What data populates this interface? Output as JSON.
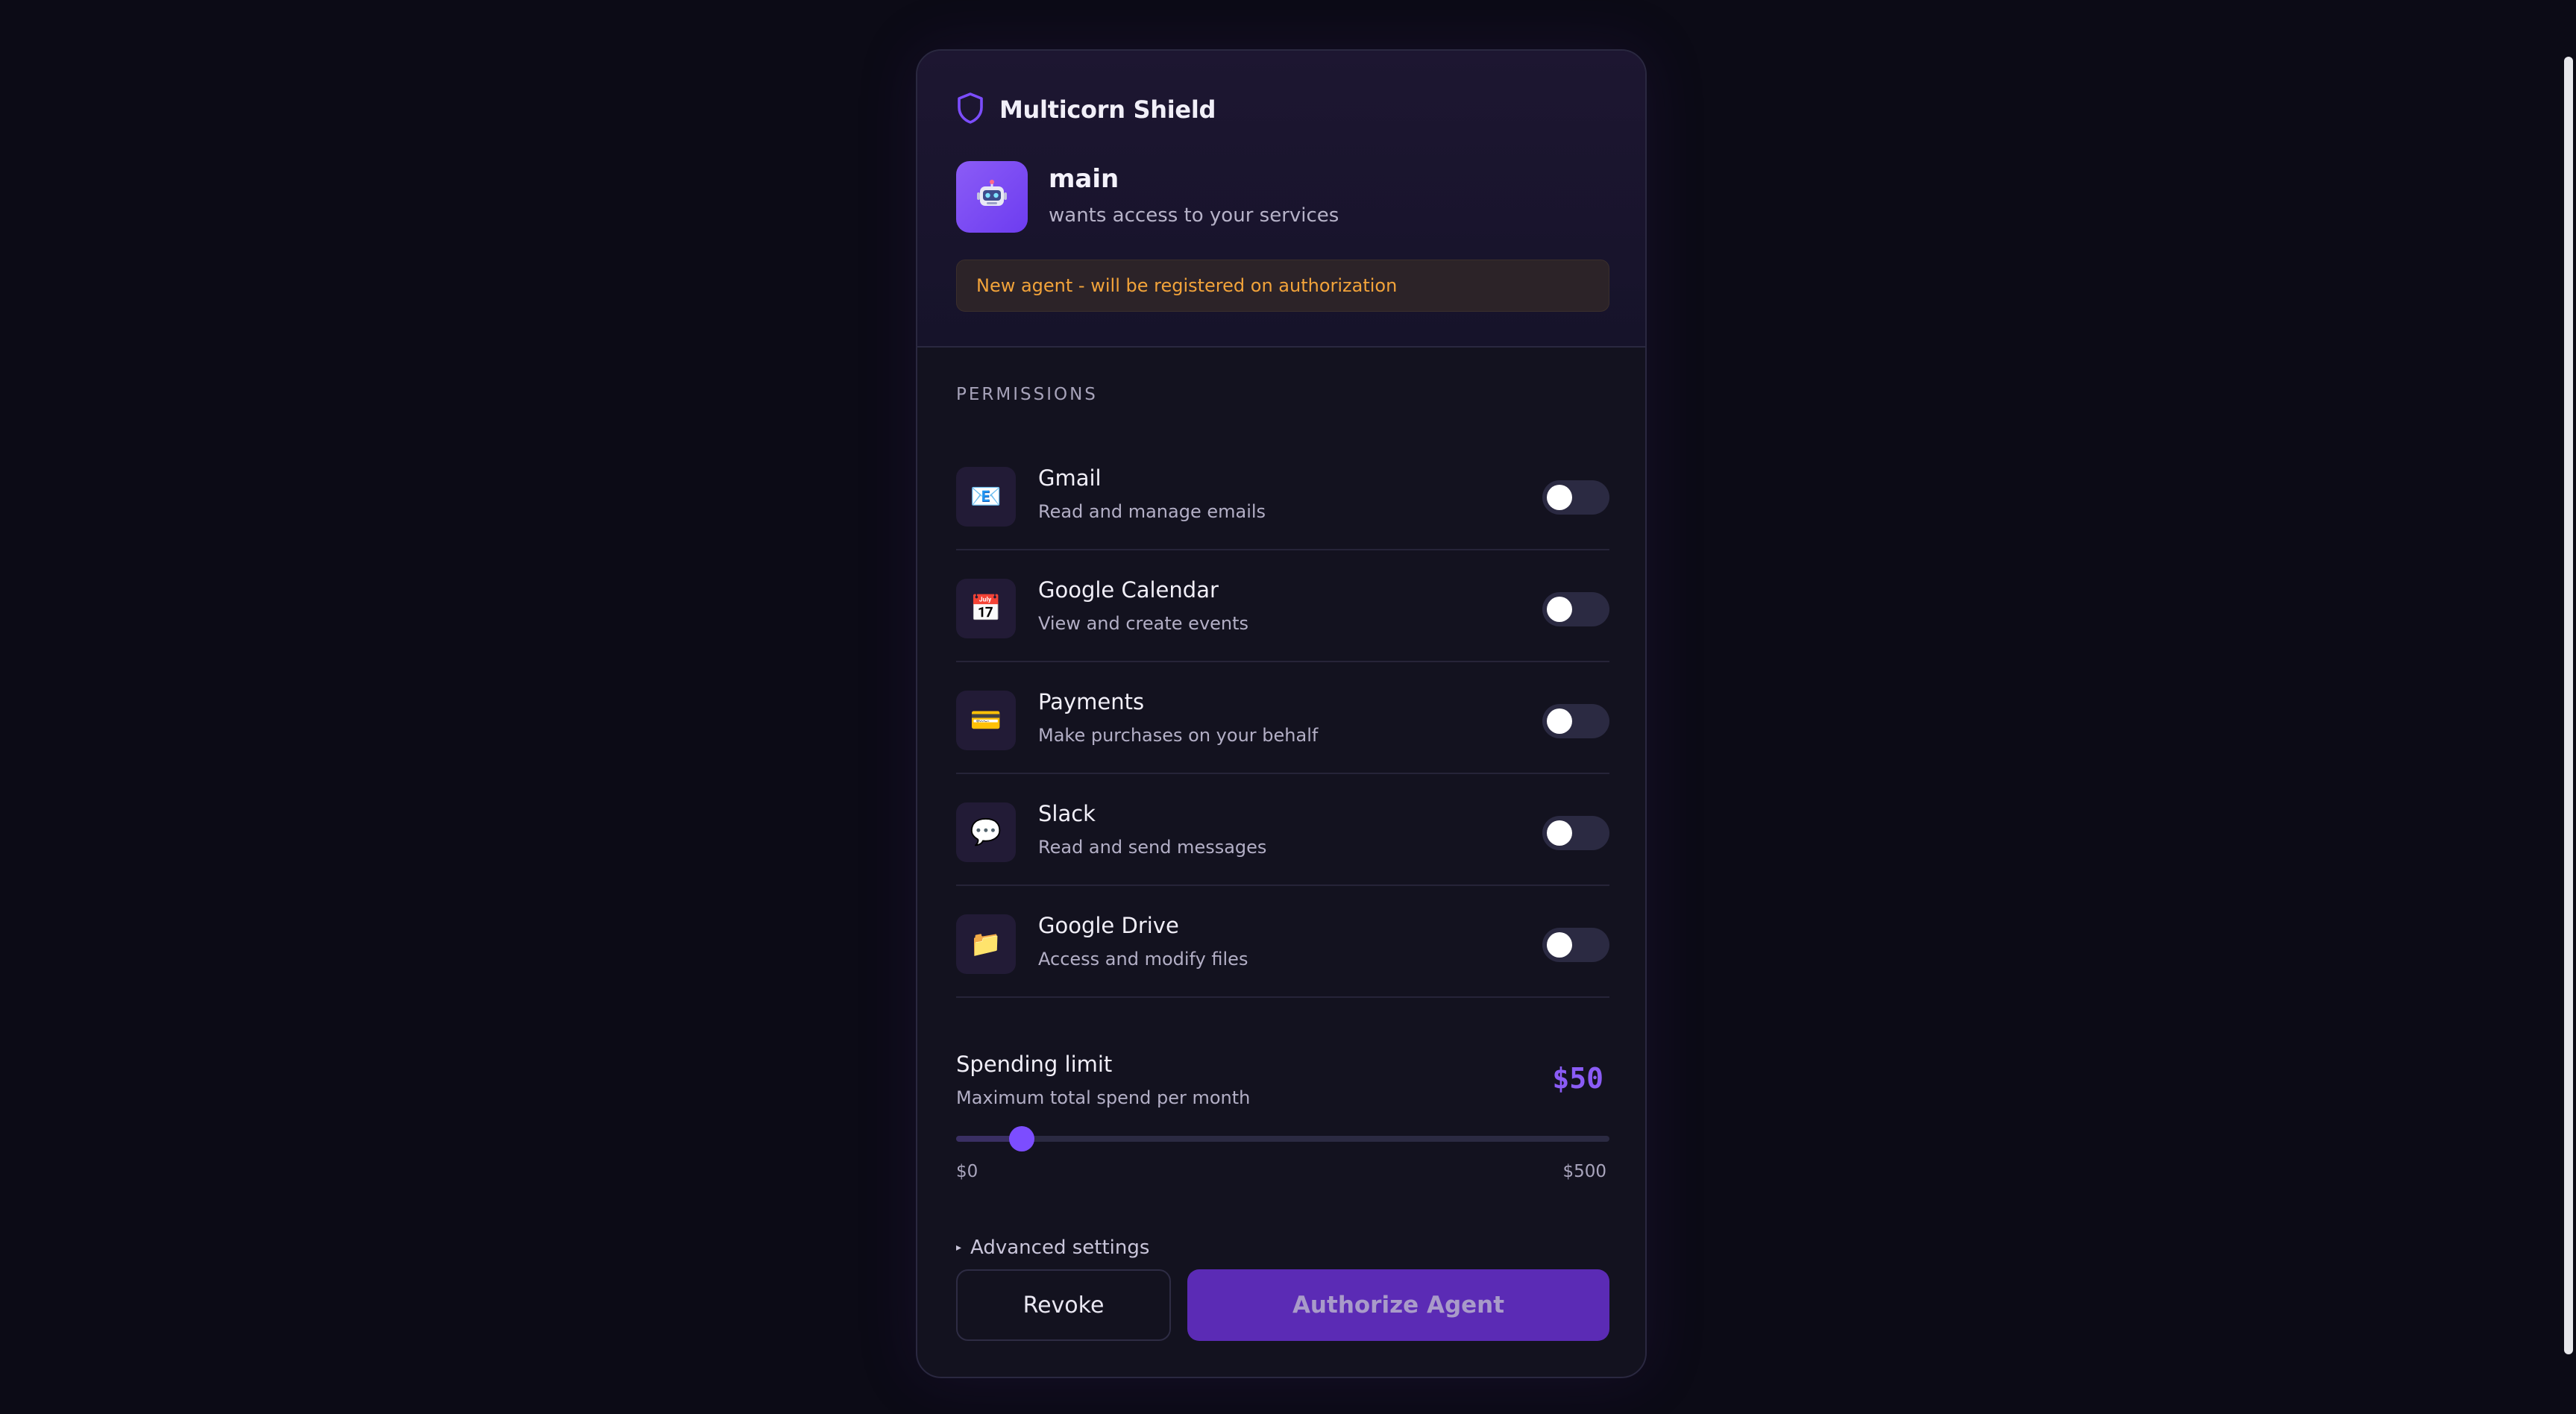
{
  "app": {
    "brand_name": "Multicorn Shield",
    "brand_icon": "shield-icon",
    "accent_color": "#7c4dff"
  },
  "agent": {
    "name": "main",
    "subtitle": "wants access to your services",
    "avatar_icon": "robot-icon",
    "notice": "New agent - will be registered on authorization"
  },
  "permissions": {
    "section_label": "PERMISSIONS",
    "items": [
      {
        "title": "Gmail",
        "description": "Read and manage emails",
        "icon": "envelope-icon",
        "glyph": "📧",
        "enabled": false
      },
      {
        "title": "Google Calendar",
        "description": "View and create events",
        "icon": "calendar-icon",
        "glyph": "📅",
        "enabled": false
      },
      {
        "title": "Payments",
        "description": "Make purchases on your behalf",
        "icon": "credit-card-icon",
        "glyph": "💳",
        "enabled": false
      },
      {
        "title": "Slack",
        "description": "Read and send messages",
        "icon": "speech-bubble-icon",
        "glyph": "💬",
        "enabled": false
      },
      {
        "title": "Google Drive",
        "description": "Access and modify files",
        "icon": "folder-icon",
        "glyph": "📁",
        "enabled": false
      }
    ]
  },
  "spending": {
    "title": "Spending limit",
    "subtitle": "Maximum total spend per month",
    "value_label": "$50",
    "value": 50,
    "min": 0,
    "max": 500,
    "min_label": "$0",
    "max_label": "$500"
  },
  "advanced": {
    "label": "Advanced settings",
    "expanded": false
  },
  "actions": {
    "revoke_label": "Revoke",
    "authorize_label": "Authorize Agent"
  }
}
